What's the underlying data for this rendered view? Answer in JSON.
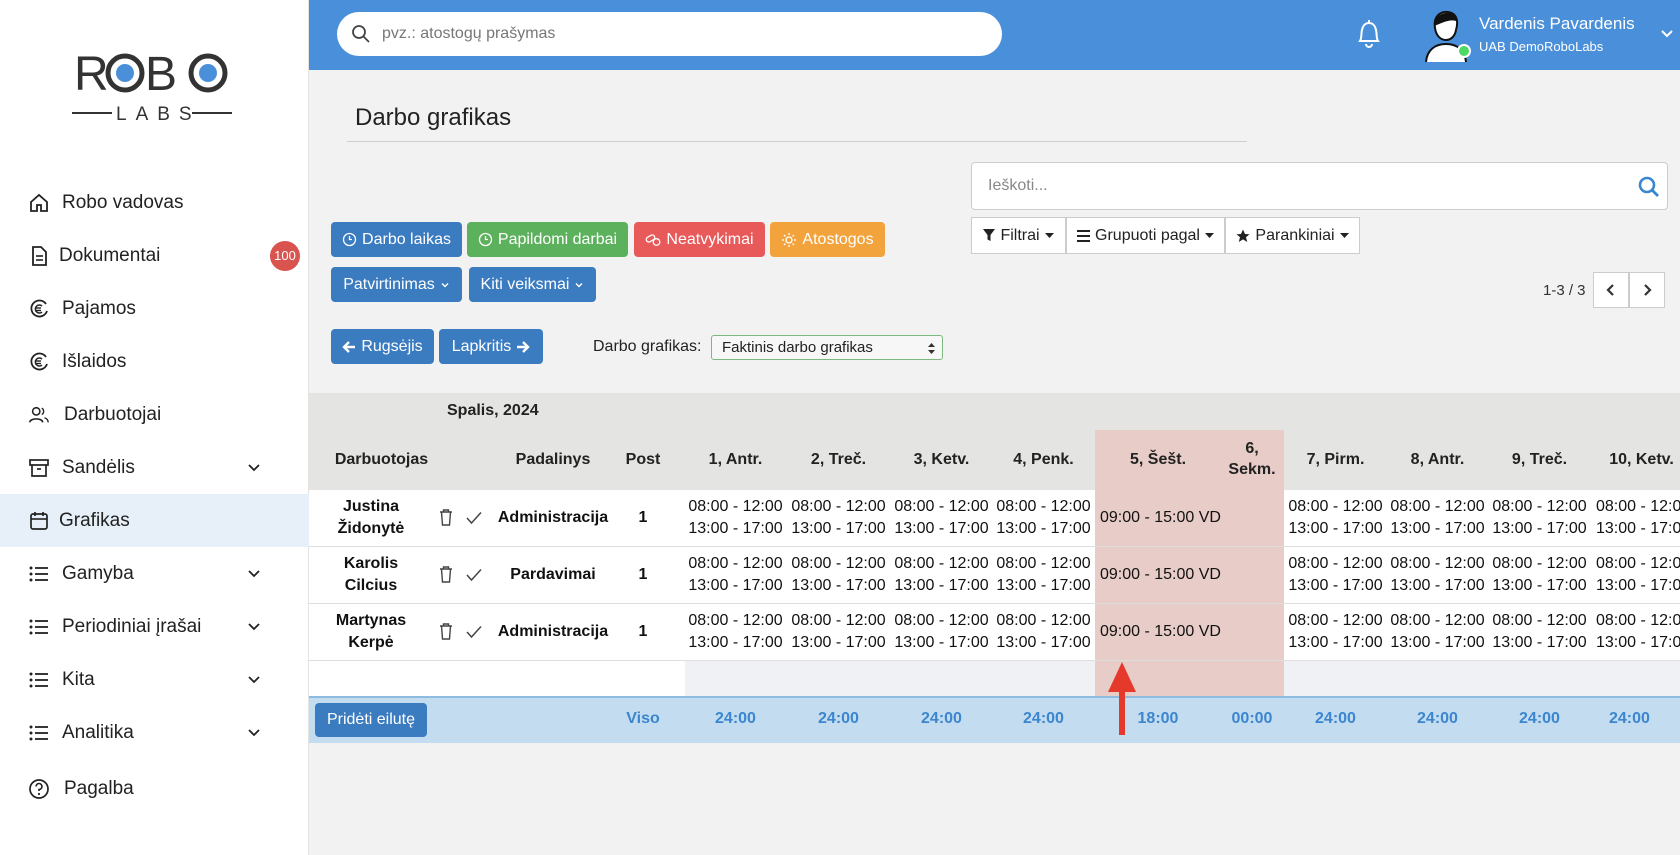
{
  "app": {
    "logo_text_main": "ROBO",
    "logo_text_sub": "LABS"
  },
  "sidebar": {
    "items": [
      {
        "label": "Robo vadovas",
        "icon": "home-icon"
      },
      {
        "label": "Dokumentai",
        "icon": "document-icon",
        "badge": "100"
      },
      {
        "label": "Pajamos",
        "icon": "euro-in-icon"
      },
      {
        "label": "Išlaidos",
        "icon": "euro-out-icon"
      },
      {
        "label": "Darbuotojai",
        "icon": "users-icon"
      },
      {
        "label": "Sandėlis",
        "icon": "warehouse-icon"
      },
      {
        "label": "Grafikas",
        "icon": "calendar-icon",
        "active": true
      },
      {
        "label": "Gamyba",
        "icon": "list-icon"
      },
      {
        "label": "Periodiniai įrašai",
        "icon": "list-icon"
      },
      {
        "label": "Kita",
        "icon": "list-icon"
      },
      {
        "label": "Analitika",
        "icon": "list-icon"
      },
      {
        "label": "Pagalba",
        "icon": "help-icon"
      }
    ]
  },
  "topbar": {
    "search_placeholder": "pvz.: atostogų prašymas",
    "user_name": "Vardenis Pavardenis",
    "user_company": "UAB DemoRoboLabs"
  },
  "page": {
    "title": "Darbo grafikas",
    "buttons": {
      "work_time": "Darbo laikas",
      "extra_work": "Papildomi darbai",
      "absences": "Neatvykimai",
      "vacations": "Atostogos",
      "confirmation": "Patvirtinimas",
      "other_actions": "Kiti veiksmai",
      "prev_month": "Rugsėjis",
      "next_month": "Lapkritis"
    },
    "search_placeholder": "Ieškoti...",
    "filters": "Filtrai",
    "group_by": "Grupuoti pagal",
    "favorites": "Parankiniai",
    "pager": "1-3 / 3",
    "schedule_label": "Darbo grafikas:",
    "schedule_value": "Faktinis darbo grafikas"
  },
  "table": {
    "month": "Spalis, 2024",
    "headers": {
      "employee": "Darbuotojas",
      "department": "Padalinys",
      "post": "Post",
      "days": [
        "1, Antr.",
        "2, Treč.",
        "3, Ketv.",
        "4, Penk.",
        "5, Šešt.",
        "6,",
        "7, Pirm.",
        "8, Antr.",
        "9, Treč.",
        "10, Ketv."
      ],
      "day6_line2": "Sekm."
    },
    "rows": [
      {
        "first": "Justina",
        "last": "Židonytė",
        "department": "Administracija",
        "post": "1"
      },
      {
        "first": "Karolis",
        "last": "Cilcius",
        "department": "Pardavimai",
        "post": "1"
      },
      {
        "first": "Martynas",
        "last": "Kerpė",
        "department": "Administracija",
        "post": "1"
      }
    ],
    "shift_line1": "08:00 - 12:00",
    "shift_line2": "13:00 - 17:00",
    "saturday_shift": "09:00 - 15:00 VD",
    "add_row": "Pridėti eilutę",
    "totals_label": "Viso",
    "totals": [
      "24:00",
      "24:00",
      "24:00",
      "24:00",
      "18:00",
      "00:00",
      "24:00",
      "24:00",
      "24:00",
      "24:00"
    ]
  },
  "colors": {
    "topbar": "#4a8fd9",
    "primary": "#3b7bbf",
    "weekend": "#e7ccc7",
    "annotation_arrow": "#e53a2b"
  }
}
